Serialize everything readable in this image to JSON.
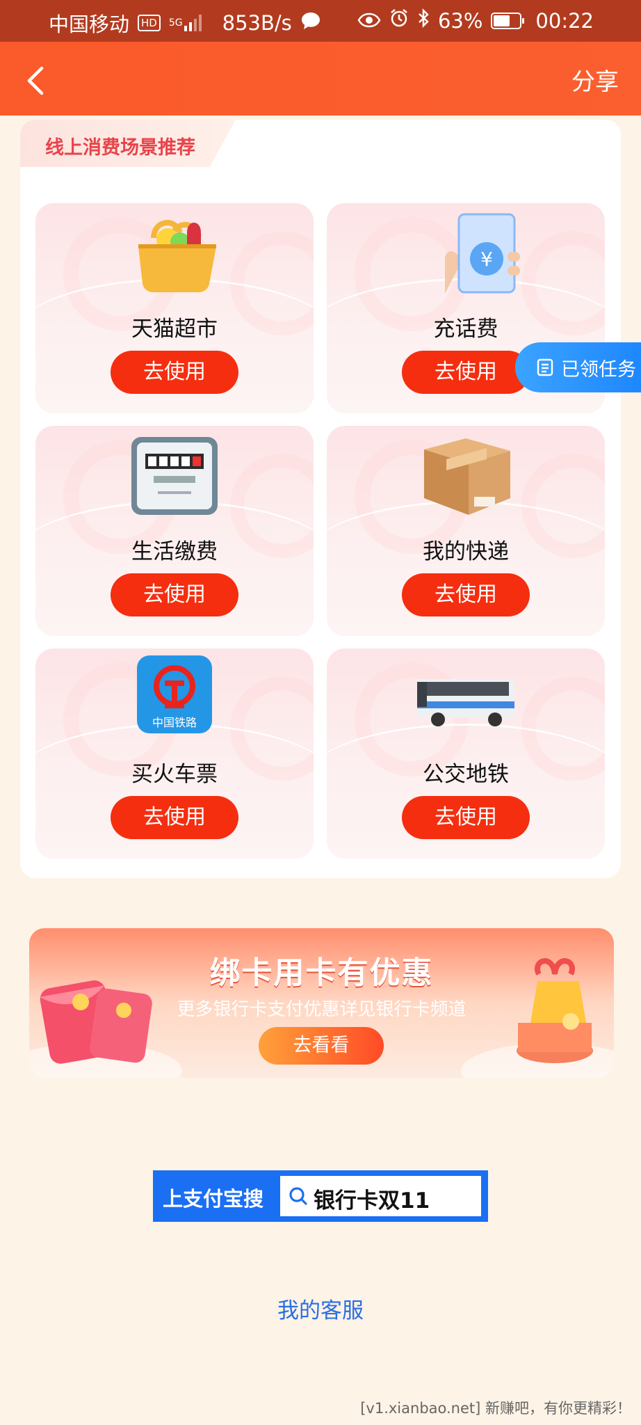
{
  "status_bar": {
    "carrier": "中国移动",
    "hd": "HD",
    "network": "5G",
    "speed": "853B/s",
    "battery_text": "63%",
    "battery_level": 0.63,
    "time": "00:22"
  },
  "nav": {
    "share_label": "分享"
  },
  "section": {
    "title": "线上消费场景推荐",
    "items": [
      {
        "label": "天猫超市",
        "button": "去使用",
        "icon": "grocery-basket-icon"
      },
      {
        "label": "充话费",
        "button": "去使用",
        "icon": "phone-recharge-icon"
      },
      {
        "label": "生活缴费",
        "button": "去使用",
        "icon": "utility-meter-icon"
      },
      {
        "label": "我的快递",
        "button": "去使用",
        "icon": "parcel-box-icon"
      },
      {
        "label": "买火车票",
        "button": "去使用",
        "icon": "china-railway-icon",
        "icon_text": "中国铁路"
      },
      {
        "label": "公交地铁",
        "button": "去使用",
        "icon": "bus-icon"
      }
    ]
  },
  "floating": {
    "task_label": "已领任务"
  },
  "banner": {
    "title": "绑卡用卡有优惠",
    "subtitle": "更多银行卡支付优惠详见银行卡频道",
    "button": "去看看"
  },
  "search": {
    "label": "上支付宝搜",
    "query": "银行卡双11"
  },
  "service_link": "我的客服",
  "footer_text": "[v1.xianbao.net] 新赚吧，有你更精彩！",
  "colors": {
    "header": "#fb5a2a",
    "status_bar": "#b23b1f",
    "button": "#f52e0f",
    "link": "#2a6fe0",
    "search_blue": "#1a6ff3"
  }
}
